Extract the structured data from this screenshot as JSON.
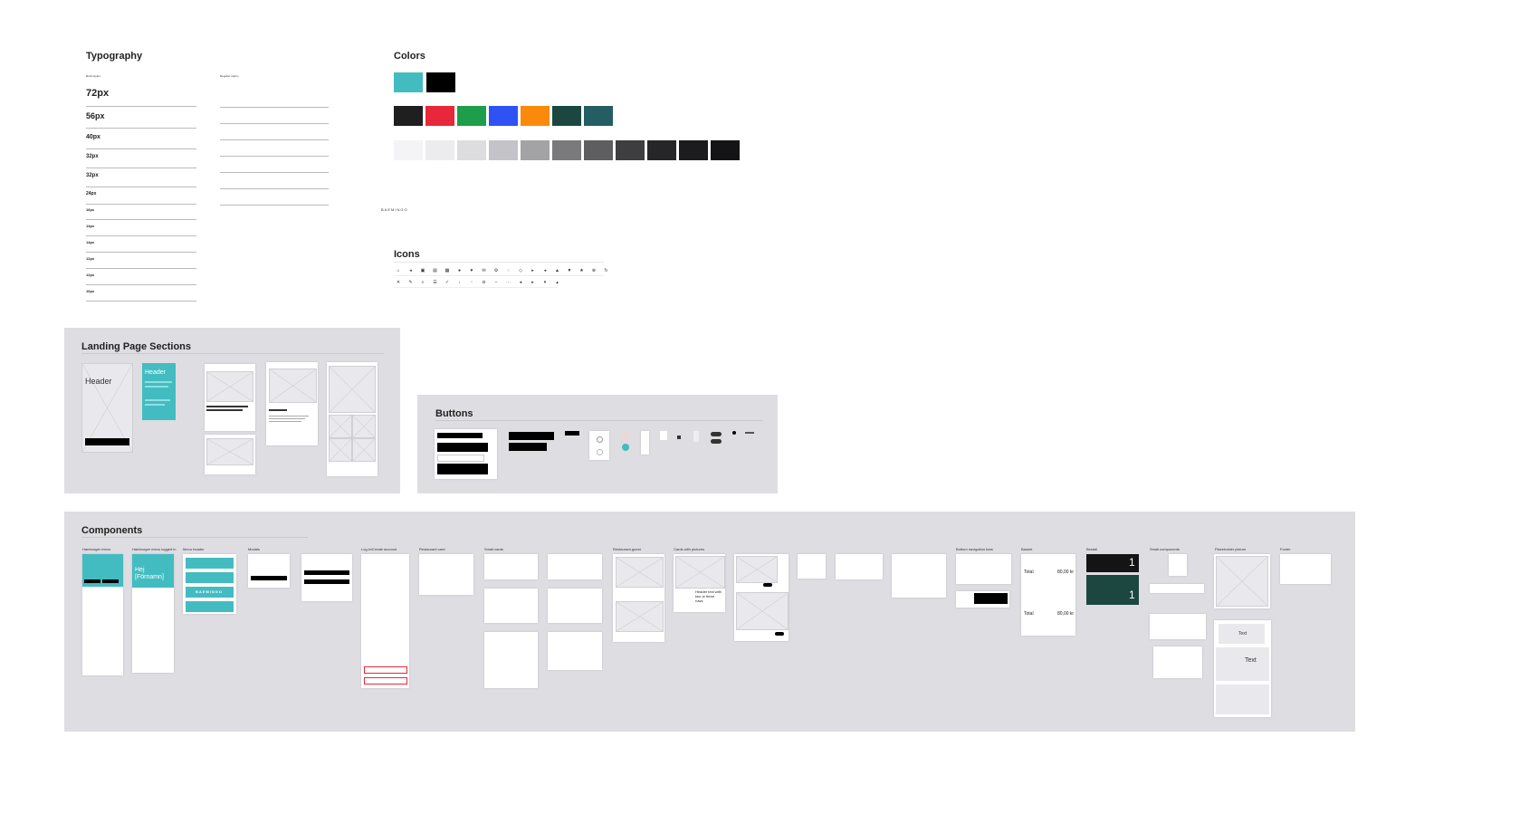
{
  "typography": {
    "title": "Typography",
    "bold_label": "Bold styles",
    "regular_label": "Regular styles",
    "sizes": [
      "72px",
      "56px",
      "40px",
      "32px",
      "32px",
      "24px",
      "16px",
      "14px",
      "14px",
      "12px",
      "12px",
      "10px"
    ]
  },
  "colors": {
    "title": "Colors",
    "brand": [
      {
        "hex": "#43bcc1"
      },
      {
        "hex": "#000000"
      }
    ],
    "accents": [
      {
        "hex": "#1f1f1f"
      },
      {
        "hex": "#e8283a"
      },
      {
        "hex": "#1e9e4a"
      },
      {
        "hex": "#2f52f5"
      },
      {
        "hex": "#fb8a0a"
      },
      {
        "hex": "#1b4740"
      },
      {
        "hex": "#245e63"
      }
    ],
    "grays": [
      {
        "hex": "#f4f4f6"
      },
      {
        "hex": "#ececee"
      },
      {
        "hex": "#dddde0"
      },
      {
        "hex": "#c4c4c8"
      },
      {
        "hex": "#a3a3a6"
      },
      {
        "hex": "#7a7a7d"
      },
      {
        "hex": "#5e5e61"
      },
      {
        "hex": "#3e3e41"
      },
      {
        "hex": "#262629"
      },
      {
        "hex": "#1c1c1f"
      },
      {
        "hex": "#141416"
      }
    ]
  },
  "logo": "BAEMINGO",
  "icons": {
    "title": "Icons"
  },
  "landing": {
    "title": "Landing Page Sections",
    "header1": "Header",
    "header2": "Header"
  },
  "buttons": {
    "title": "Buttons"
  },
  "components": {
    "title": "Components",
    "cols": [
      {
        "label": "Hamburger menu"
      },
      {
        "label": "Hamburger menu logged in"
      },
      {
        "label": "Menu header"
      },
      {
        "label": "Modals"
      },
      {
        "label": "Log in/Create account"
      },
      {
        "label": "Restaurant card"
      },
      {
        "label": "Small cards"
      },
      {
        "label": "Restaurant-guest"
      },
      {
        "label": "Cards with pictures"
      },
      {
        "label": "Bottom navigation bars"
      },
      {
        "label": "Basket"
      },
      {
        "label": "Bestall"
      },
      {
        "label": "Small components"
      },
      {
        "label": "Placeholder picture"
      },
      {
        "label": "Footer"
      }
    ],
    "greeting": "Hej [Förnamn]",
    "logo_small": "BAEMINGO",
    "total1": "Total",
    "total2": "Total",
    "price1": "80,00 kr",
    "price2": "80,00 kr",
    "badge1": "1",
    "badge2": "1",
    "card_text": "Header text with two or three rows",
    "text_label": "Text",
    "text_label2": "Text"
  }
}
